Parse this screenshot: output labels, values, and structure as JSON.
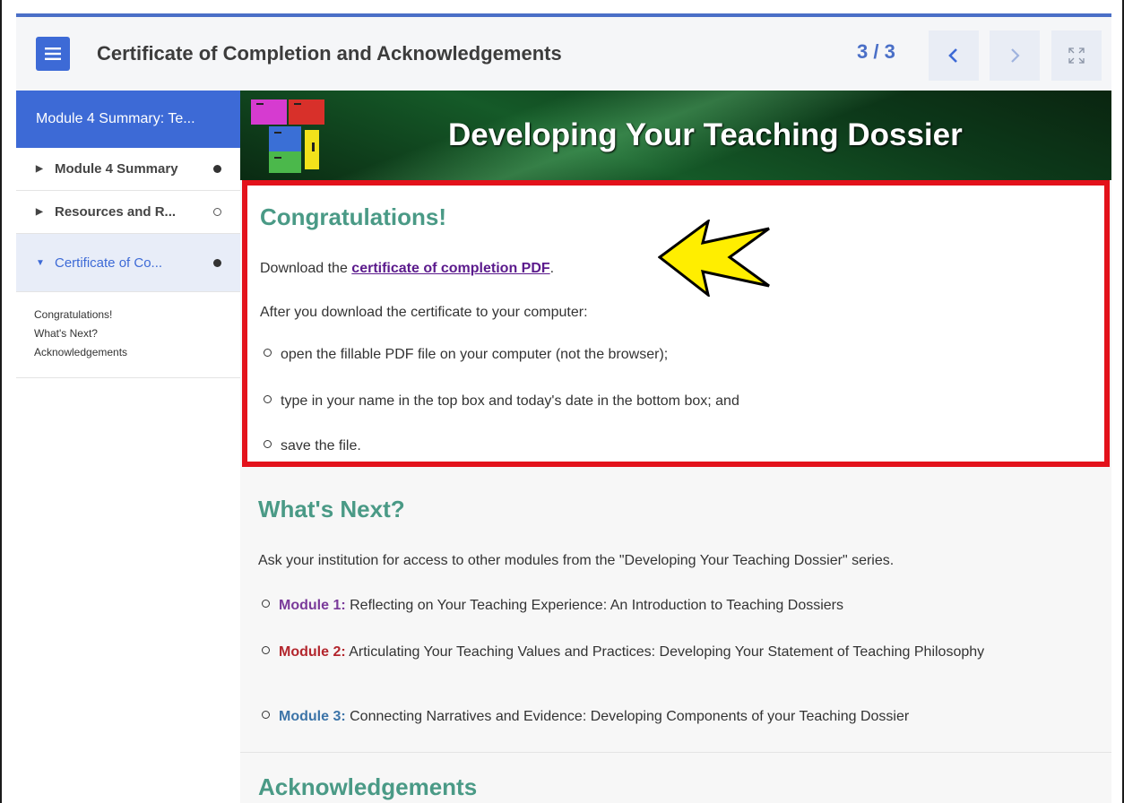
{
  "header": {
    "title": "Certificate of Completion and Acknowledgements",
    "page_count": "3 / 3"
  },
  "sidebar": {
    "header": "Module 4 Summary: Te...",
    "items": [
      {
        "label": "Module 4 Summary",
        "status": "filled"
      },
      {
        "label": "Resources and R...",
        "status": "empty"
      },
      {
        "label": "Certificate of Co...",
        "status": "filled"
      }
    ],
    "subitems": [
      "Congratulations!",
      "What's Next?",
      "Acknowledgements"
    ]
  },
  "banner": {
    "title": "Developing Your Teaching Dossier"
  },
  "congrats": {
    "heading": "Congratulations!",
    "download_prefix": "Download the ",
    "download_link": "certificate of completion PDF",
    "download_suffix": ".",
    "after_text": "After you download the certificate to your computer:",
    "steps": [
      "open the fillable PDF file on your computer (not the browser);",
      "type in your name in the top box and today's date in the bottom box; and",
      "save the file."
    ]
  },
  "whats_next": {
    "heading": "What's Next?",
    "intro": "Ask your institution for access to other modules from the \"Developing Your Teaching Dossier\" series.",
    "modules": [
      {
        "label": "Module 1:",
        "text": " Reflecting on Your Teaching Experience: An Introduction to Teaching Dossiers"
      },
      {
        "label": "Module 2:",
        "text": " Articulating Your Teaching Values and Practices: Developing Your Statement of Teaching Philosophy"
      },
      {
        "label": "Module 3:",
        "text": " Connecting Narratives and Evidence: Developing Components of your Teaching Dossier"
      }
    ]
  },
  "acknowledgements": {
    "heading": "Acknowledgements"
  },
  "colors": {
    "accent": "#3d6ad6",
    "heading": "#4a9a86",
    "highlight_border": "#e3121b",
    "arrow": "#ffee00"
  }
}
